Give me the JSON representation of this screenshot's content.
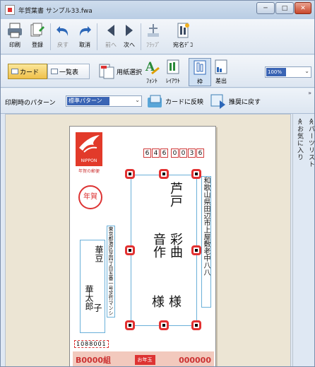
{
  "window": {
    "title": "年賀葉書 サンプル33.fwa",
    "buttons": {
      "minimize": "─",
      "maximize": "□",
      "close": "✕"
    }
  },
  "toolbar1": {
    "print": "印刷",
    "register": "登録",
    "undo": "戻す",
    "cancel": "取消",
    "prev": "前へ",
    "next": "次へ",
    "flap": "ﾌﾗｯﾌﾟ",
    "address_deco": "宛名ﾃﾞｺ"
  },
  "toolbar2": {
    "card": "カード",
    "list": "一覧表",
    "paper_select": "用紙選択",
    "font": "ﾌｫﾝﾄ",
    "layout": "ﾚｲｱｳﾄ",
    "frame": "枠",
    "sender": "差出",
    "zoom": "100%"
  },
  "toolbar3": {
    "pattern_label": "印刷時のパターン",
    "pattern_value": "標準パターン",
    "apply_card": "カードに反映",
    "reset_default": "推奨に戻す"
  },
  "side_tabs": {
    "favorites": "≪お気に入り",
    "parts_list": "≪パーツリスト"
  },
  "card": {
    "stamp_caption": "NIPPON",
    "stamp_sub": "年賀の郵便",
    "nenga_mark": "年賀",
    "postal_code": [
      "6",
      "4",
      "6",
      "0",
      "0",
      "3",
      "6"
    ],
    "recipient_address": "和歌山県田辺市上屋敷老中八八",
    "recipient_name_1": "芦戸",
    "recipient_name_2": "彩曲",
    "recipient_name_3": "音作",
    "honorific": "様",
    "sender_address": "東京都港区芝四丁目五番一号芝竹マンション〇〇号",
    "sender_name_1": "華豆",
    "sender_name_2": "華太郎",
    "sender_name_3": "子",
    "sender_postal": "1088001",
    "lottery_left": "B0000組",
    "lottery_right": "000000",
    "lottery_logo": "お年玉"
  }
}
